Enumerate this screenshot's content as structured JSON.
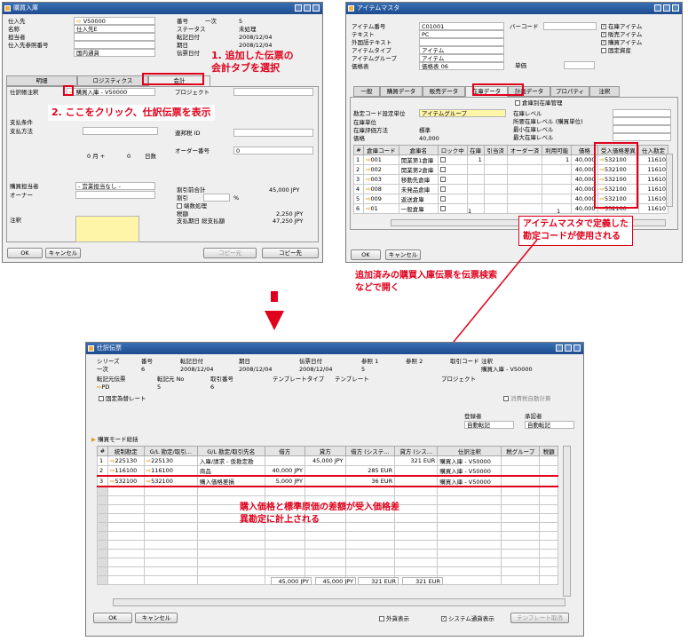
{
  "w1": {
    "title": "購買入庫",
    "left": [
      {
        "l": "仕入先",
        "v": "V50000",
        "a": true
      },
      {
        "l": "名称",
        "v": "仕入先E"
      },
      {
        "l": "担当者",
        "v": ""
      },
      {
        "l": "仕入先参照番号",
        "v": ""
      },
      {
        "l": "",
        "v": "国内通貨"
      }
    ],
    "right": [
      {
        "l": "番号",
        "v": "一次",
        "v2": "5"
      },
      {
        "l": "ステータス",
        "v2": "未処理"
      },
      {
        "l": "転記日付",
        "v2": "2008/12/04"
      },
      {
        "l": "期日",
        "v2": "2008/12/04"
      },
      {
        "l": "伝票日付",
        "v2": ""
      }
    ],
    "tabs": [
      "明細",
      "ロジスティクス",
      "会計"
    ],
    "jrnl_label": "仕訳帳注釈",
    "jrnl_value": "購買入庫 - V50000",
    "project": "プロジェクト",
    "pay_terms": "支払条件",
    "pay_method": "支払方法",
    "tax_id": "連邦税 ID",
    "months": "0 月 +",
    "days": "0",
    "days_label": "日数",
    "order_no": "オーダー番号",
    "order_val": "0",
    "buyer_label": "購買担当者",
    "buyer_val": "- 営業担当なし -",
    "owner": "オーナー",
    "remarks": "注釈",
    "total_before": "割引前合計",
    "total_before_v": "45,000 JPY",
    "discount": "割引",
    "pct": "%",
    "round": "端数処理",
    "tax": "税額",
    "tax_v": "2,250 JPY",
    "total_due": "支払期日 総支払額",
    "total_due_v": "47,250 JPY",
    "ok": "OK",
    "cancel": "キャンセル",
    "copy_from": "コピー元",
    "copy_to": "コピー先"
  },
  "w2": {
    "title": "アイテムマスタ",
    "fields": [
      {
        "l": "アイテム番号",
        "v": "C01001"
      },
      {
        "l": "テキスト",
        "v": "PC"
      },
      {
        "l": "外国語テキスト",
        "v": ""
      },
      {
        "l": "アイテムタイプ",
        "v": "アイテム"
      },
      {
        "l": "アイテムグループ",
        "v": "アイテム"
      },
      {
        "l": "価格表",
        "v": "価格表 06"
      }
    ],
    "barcode": "バーコード",
    "unitprice": "単価",
    "checks": [
      {
        "l": "在庫アイテム",
        "c": true
      },
      {
        "l": "販売アイテム",
        "c": true
      },
      {
        "l": "購買アイテム",
        "c": true
      },
      {
        "l": "固定資産",
        "c": false
      }
    ],
    "tabs": [
      "一般",
      "購買データ",
      "販売データ",
      "在庫データ",
      "計画データ",
      "プロパティ",
      "注釈"
    ],
    "wh_mgmt": "倉庫別在庫管理",
    "acct_by": "勘定コード設定単位",
    "acct_by_v": "アイテムグループ",
    "stock_unit": "在庫単位",
    "val_method": "在庫評価方法",
    "val_method_v": "標準",
    "price": "価格",
    "price_v": "40,000",
    "levels": [
      "在庫レベル",
      "所要在庫レベル (購買単位)",
      "最小在庫レベル",
      "最大在庫レベル"
    ],
    "cols": [
      "#",
      "倉庫コード",
      "倉庫名",
      "ロック中",
      "在庫",
      "引当済",
      "オーダー済",
      "利用可能",
      "価格",
      "受入価格差異",
      "仕入勘定"
    ],
    "rows": [
      [
        "1",
        "001",
        "開業第1倉庫",
        "",
        "1",
        "",
        "",
        "1",
        "40,000",
        "532100",
        "11610"
      ],
      [
        "2",
        "002",
        "開業第2倉庫",
        "",
        "",
        "",
        "",
        "",
        "40,000",
        "532100",
        "11610"
      ],
      [
        "3",
        "003",
        "移動先倉庫",
        "",
        "",
        "",
        "",
        "",
        "40,000",
        "532100",
        "11610"
      ],
      [
        "4",
        "008",
        "未発品倉庫",
        "",
        "",
        "",
        "",
        "",
        "40,000",
        "532100",
        "11610"
      ],
      [
        "5",
        "009",
        "返送倉庫",
        "",
        "",
        "",
        "",
        "",
        "40,000",
        "532100",
        "11610"
      ],
      [
        "6",
        "01",
        "一般倉庫",
        "",
        "",
        "",
        "",
        "",
        "40,000",
        "532100",
        "11610"
      ]
    ],
    "tot": "1",
    "tot2": "1",
    "ok": "OK",
    "cancel": "キャンセル"
  },
  "w3": {
    "title": "仕訳伝票",
    "hdr": [
      "シリーズ",
      "番号",
      "転記日付",
      "期日",
      "伝票日付",
      "参照 1",
      "参照 2",
      "取引コード",
      "注釈"
    ],
    "hdrv": [
      "一次",
      "6",
      "2008/12/04",
      "2008/12/04",
      "2008/12/04",
      "5",
      "",
      "",
      "購買入庫 - V50000"
    ],
    "hdr2": [
      "転記元伝票",
      "転記元 No",
      "取引番号",
      "テンプレートタイプ",
      "テンプレート",
      "プロジェクト"
    ],
    "hdr2v": [
      "PD",
      "5",
      "6",
      "",
      "",
      ""
    ],
    "fixed_rate": "固定為替レート",
    "auto_tax": "消費税自動計算",
    "created_by": "登録者",
    "approved_by": "承認者",
    "created_v": "自動転記",
    "approved_v": "自動転記",
    "mode": "購買モード総括",
    "cols": [
      "#",
      "統制勘定",
      "G/L 勘定/取引...",
      "G/L 勘定/取引先名",
      "借方",
      "貸方",
      "借方 (システ...",
      "貸方 (シス...",
      "仕訳注釈",
      "税グループ",
      "税額"
    ],
    "rows": [
      [
        "1",
        "225130",
        "225130",
        "入庫/請求 - 仮勘定勘",
        "",
        "45,000 JPY",
        "",
        "321 EUR",
        "購買入庫 - V50000",
        "",
        ""
      ],
      [
        "2",
        "116100",
        "116100",
        "商品",
        "40,000 JPY",
        "",
        "285 EUR",
        "",
        "購買入庫 - V50000",
        "",
        ""
      ],
      [
        "3",
        "532100",
        "532100",
        "購入価格差損",
        "5,000 JPY",
        "",
        "36 EUR",
        "",
        "購買入庫 - V50000",
        "",
        ""
      ]
    ],
    "totals": [
      "45,000 JPY",
      "45,000 JPY",
      "321 EUR",
      "321 EUR"
    ],
    "ok": "OK",
    "cancel": "キャンセル",
    "foreign": "外貨表示",
    "sys": "システム通貨表示",
    "tmpl": "テンプレート取消"
  },
  "notes": {
    "n1a": "1. 追加した伝票の",
    "n1b": "会計タブを選択",
    "n2": "2. ここをクリック、仕訳伝票を表示",
    "n3a": "アイテムマスタで定義した",
    "n3b": "勘定コードが使用される",
    "n4a": "追加済みの購買入庫伝票を伝票検索",
    "n4b": "などで開く",
    "n5a": "購入価格と標準原価の差額が受入価格差",
    "n5b": "異勘定に計上される"
  },
  "colors": {
    "red": "#e0001b",
    "title": "#2a5ea8",
    "arrow": "#e39b16",
    "yellow": "#fff5a8"
  }
}
